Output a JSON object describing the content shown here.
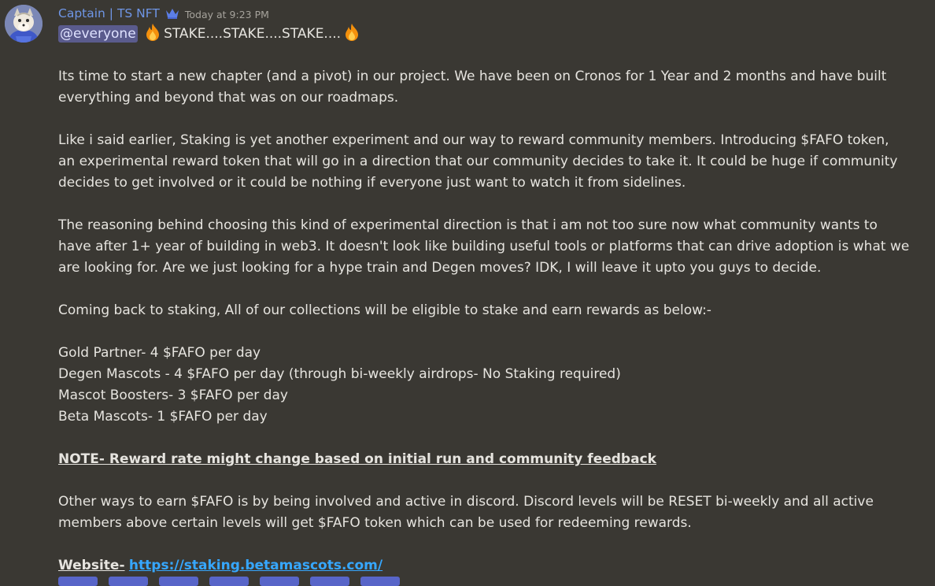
{
  "message": {
    "author": "Captain | TS NFT",
    "timestamp": "Today at 9:23 PM",
    "mention": "@everyone",
    "headline": "STAKE....STAKE....STAKE....",
    "intro": [
      "Its time to start a new chapter (and a pivot) in our project. We have been on Cronos for 1 Year and 2 months and have built",
      "everything and beyond that was on our roadmaps."
    ],
    "staking_intro": [
      "Like i said earlier, Staking is yet another experiment and our way to reward community members. Introducing $FAFO token,",
      "an experimental reward token that will go in a direction that our community decides to take it. It could be huge if community",
      "decides to get involved or it could be nothing if everyone just want to watch it from sidelines."
    ],
    "reasoning": [
      "The reasoning behind choosing this kind of experimental direction is that i am not too sure now what community wants to",
      "have after 1+ year of building in web3. It doesn't look like building useful tools or platforms that can drive adoption is what we",
      "are looking for. Are we just looking for a hype train and Degen moves? IDK, I will leave it upto you guys to decide."
    ],
    "collections_intro": "Coming back to staking, All of our collections will be eligible to stake and earn rewards as below:-",
    "rewards": [
      "Gold Partner- 4 $FAFO per day",
      "Degen Mascots - 4 $FAFO per day (through bi-weekly airdrops- No Staking required)",
      "Mascot Boosters- 3 $FAFO per day",
      "Beta Mascots- 1 $FAFO per day"
    ],
    "note": "NOTE- Reward rate might change based on initial run and community feedback",
    "other_ways": [
      "Other ways to earn $FAFO is by being involved and active in discord. Discord levels will be RESET bi-weekly and all active",
      "members above certain levels will get $FAFO token which can be used for redeeming rewards."
    ],
    "website_label": "Website-",
    "website_url": "https://staking.betamascots.com/"
  },
  "colors": {
    "background": "#3a3833",
    "username": "#6f96e6",
    "mention_bg": "#5a5b8d",
    "link": "#36a7ff"
  },
  "icons": {
    "avatar": "fox-avatar",
    "badge": "crown-icon",
    "emoji": "fire-icon"
  }
}
